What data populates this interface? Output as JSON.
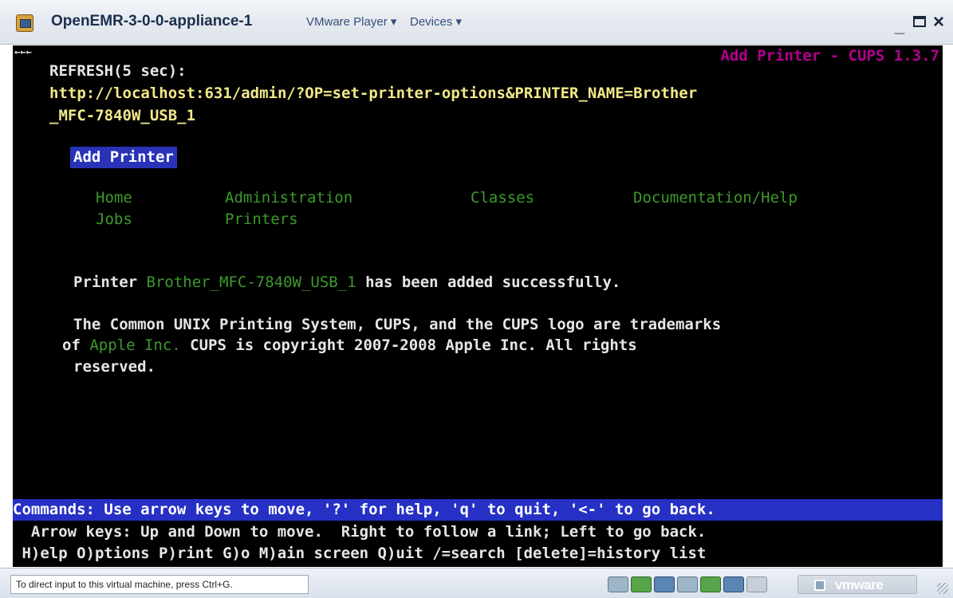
{
  "window": {
    "title": "OpenEMR-3-0-0-appliance-1",
    "menu_player": "VMware Player ▾",
    "menu_devices": "Devices ▾",
    "btn_minimize": "_",
    "btn_close": "×"
  },
  "terminal": {
    "back_arrow": "←←←",
    "top_title": "Add Printer - CUPS 1.3.7",
    "refresh_label": "REFRESH(5 sec):",
    "url_line1": "http://localhost:631/admin/?OP=set-printer-options&PRINTER_NAME=Brother",
    "url_line2": "_MFC-7840W_USB_1",
    "selected_link": "Add Printer",
    "nav": {
      "home": "Home",
      "administration": "Administration",
      "classes": "Classes",
      "documentation": "Documentation/Help",
      "jobs": "Jobs",
      "printers": "Printers"
    },
    "message": {
      "prefix": "Printer ",
      "printer_link": "Brother_MFC-7840W_USB_1",
      "suffix": " has been added successfully."
    },
    "footer": {
      "line1": "The Common UNIX Printing System, CUPS, and the CUPS logo are trademarks",
      "line2_prefix": "of ",
      "apple_link": "Apple Inc.",
      "line2_suffix": " CUPS is copyright 2007-2008 Apple Inc. All rights",
      "line3": "reserved."
    },
    "status_line": "Commands: Use arrow keys to move, '?' for help, 'q' to quit, '<-' to go back.",
    "help_line1": "  Arrow keys: Up and Down to move.  Right to follow a link; Left to go back.",
    "help_line2": " H)elp O)ptions P)rint G)o M)ain screen Q)uit /=search [delete]=history list"
  },
  "statusbar": {
    "hint": "To direct input to this virtual machine, press Ctrl+G.",
    "vmware_logo": "vmware"
  },
  "colors": {
    "terminal_bg": "#000000",
    "link_green": "#3c9a2a",
    "url_yellow": "#f2e88a",
    "title_magenta": "#b40090",
    "status_blue": "#2630c4"
  }
}
